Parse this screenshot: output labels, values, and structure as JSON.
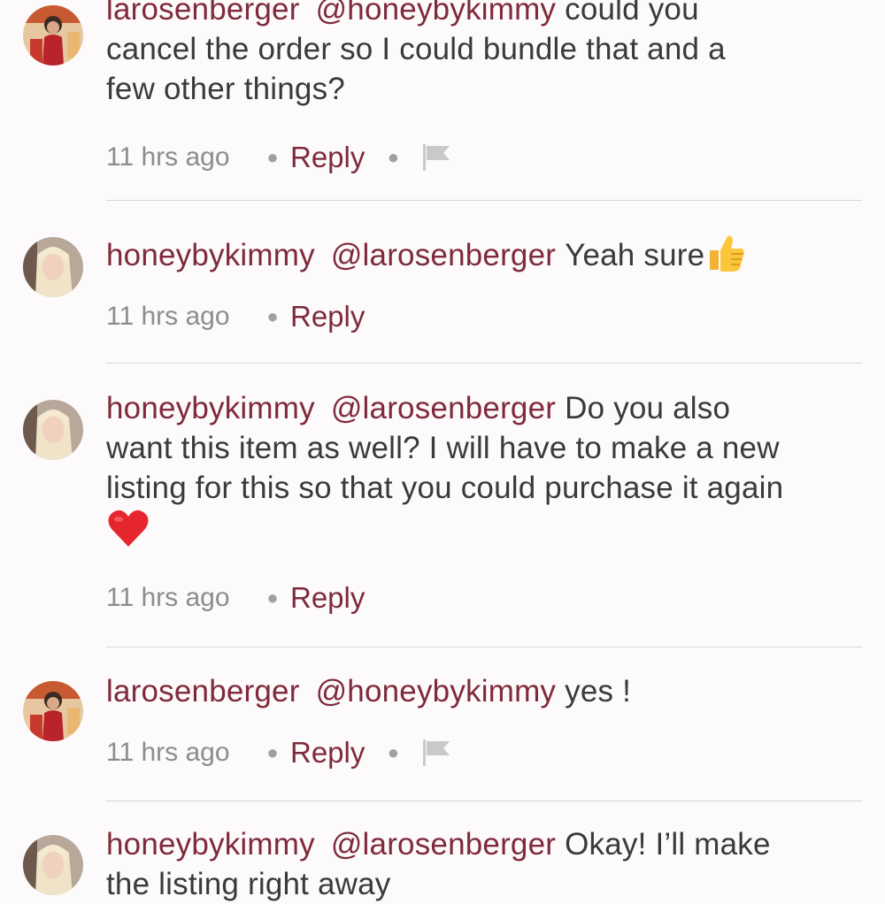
{
  "comments": [
    {
      "username": "larosenberger",
      "mention": "@honeybykimmy",
      "text_lines": [
        "could you",
        "cancel the order so I could bundle that and a",
        "few other things?"
      ],
      "time": "11 hrs ago",
      "reply_label": "Reply",
      "has_flag": true,
      "avatar_icon": "avatar-larosenberger"
    },
    {
      "username": "honeybykimmy",
      "mention": "@larosenberger",
      "text": "Yeah sure",
      "emoji": "thumbs-up",
      "time": "11 hrs ago",
      "reply_label": "Reply",
      "has_flag": false,
      "avatar_icon": "avatar-honeybykimmy"
    },
    {
      "username": "honeybykimmy",
      "mention": "@larosenberger",
      "text_lines": [
        "Do you also",
        "want this item as well? I will have to make a new",
        "listing for this so that you could purchase it again"
      ],
      "emoji": "red-heart",
      "time": "11 hrs ago",
      "reply_label": "Reply",
      "has_flag": false,
      "avatar_icon": "avatar-honeybykimmy"
    },
    {
      "username": "larosenberger",
      "mention": "@honeybykimmy",
      "text": "yes !",
      "time": "11 hrs ago",
      "reply_label": "Reply",
      "has_flag": true,
      "avatar_icon": "avatar-larosenberger"
    },
    {
      "username": "honeybykimmy",
      "mention": "@larosenberger",
      "text_lines": [
        "Okay! I’ll make",
        "the listing right away"
      ],
      "avatar_icon": "avatar-honeybykimmy"
    }
  ],
  "colors": {
    "username": "#7f2a3b",
    "body_text": "#3a3a3a",
    "time": "#8d8d8d",
    "background": "#fcfafb"
  }
}
